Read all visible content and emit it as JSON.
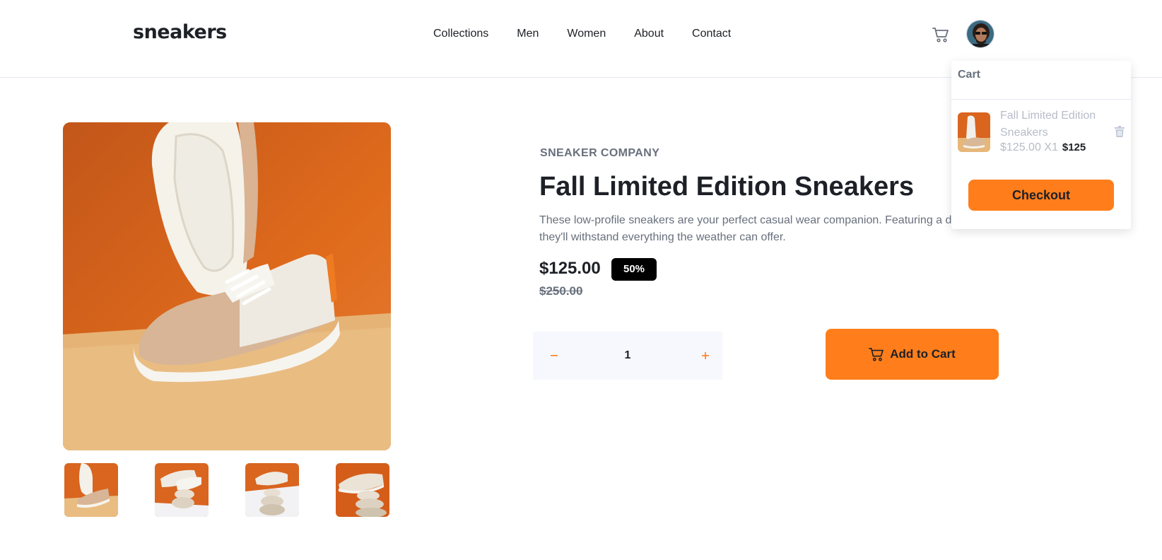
{
  "header": {
    "logo": "sneakers",
    "nav": [
      "Collections",
      "Men",
      "Women",
      "About",
      "Contact"
    ]
  },
  "cart": {
    "title": "Cart",
    "item_name": "Fall Limited Edition Sneakers",
    "item_price_qty": "$125.00 X1",
    "item_total": "$125",
    "checkout_label": "Checkout"
  },
  "product": {
    "company": "SNEAKER COMPANY",
    "title": "Fall Limited Edition Sneakers",
    "description_line1": "These low-profile sneakers are your perfect casual wear companion. Featuring a d",
    "description_line2": "they'll withstand everything the weather can offer.",
    "price": "$125.00",
    "discount": "50%",
    "old_price": "$250.00",
    "quantity": "1",
    "add_to_cart_label": "Add to Cart"
  },
  "icons": {
    "cart": "cart-icon",
    "trash": "trash-icon",
    "minus": "minus-icon",
    "plus": "plus-icon"
  },
  "colors": {
    "accent": "#ff7e1b",
    "text_dark": "#1d2026",
    "text_grey": "#68707d"
  }
}
